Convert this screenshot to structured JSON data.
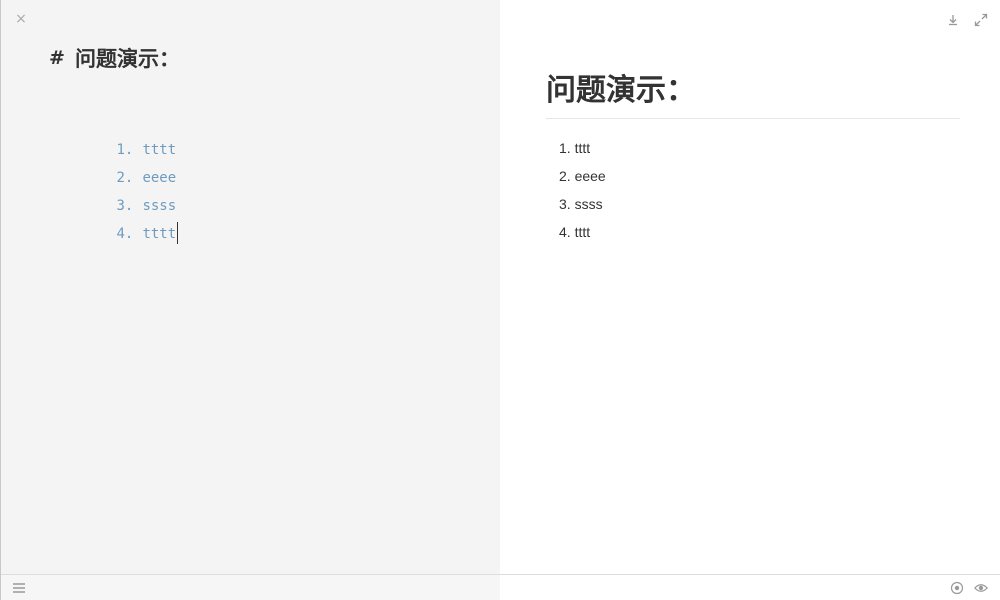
{
  "editor": {
    "close_icon": "close-icon",
    "heading_marker": "#",
    "heading_text": "问题演示：",
    "list": [
      {
        "number": "1.",
        "text": "tttt"
      },
      {
        "number": "2.",
        "text": "eeee"
      },
      {
        "number": "3.",
        "text": "ssss"
      },
      {
        "number": "4.",
        "text": "tttt"
      }
    ],
    "colors": {
      "background": "#f4f4f4",
      "list_text": "#6f9bbf",
      "heading_text": "#333333"
    }
  },
  "preview": {
    "toolbar_icons": [
      "download-icon",
      "fullscreen-icon"
    ],
    "heading": "问题演示：",
    "list": [
      "tttt",
      "eeee",
      "ssss",
      "tttt"
    ]
  },
  "bottombar": {
    "left_icon": "menu-icon",
    "right_icons": [
      "sync-scroll-icon",
      "preview-eye-icon"
    ]
  }
}
